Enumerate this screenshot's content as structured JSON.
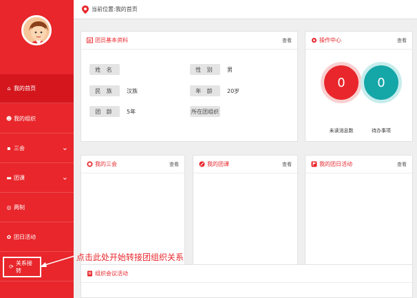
{
  "sidebar": {
    "items": [
      {
        "label": "我的首页",
        "icon": "home-icon"
      },
      {
        "label": "我的组织",
        "icon": "people-icon"
      },
      {
        "label": "三会",
        "icon": "clipboard-icon"
      },
      {
        "label": "团课",
        "icon": "folder-icon"
      },
      {
        "label": "两制",
        "icon": "target-icon"
      },
      {
        "label": "团日活动",
        "icon": "flower-icon"
      },
      {
        "label": "关系接转",
        "icon": "transfer-icon"
      }
    ]
  },
  "topbar": {
    "location": "当前位置:我的首页"
  },
  "profile": {
    "title": "团员基本资料",
    "more": "查看",
    "fields": {
      "name_label": "姓 名",
      "name_value": "",
      "gender_label": "性 别",
      "gender_value": "男",
      "ethnicity_label": "民 族",
      "ethnicity_value": "汉族",
      "age_label": "年 龄",
      "age_value": "20岁",
      "league_age_label": "团 龄",
      "league_age_value": "5年",
      "org_label": "所在团组织",
      "org_value": ""
    }
  },
  "ops": {
    "title": "操作中心",
    "more": "查看",
    "unread_count": "0",
    "unread_label": "未读消息数",
    "todo_count": "0",
    "todo_label": "待办事项"
  },
  "three_meetings": {
    "title": "我的三会",
    "more": "查看"
  },
  "league_class": {
    "title": "我的团课",
    "more": "查看"
  },
  "league_day": {
    "title": "我的团日活动",
    "more": "查看"
  },
  "org_meeting": {
    "title": "组织会议活动"
  },
  "annotation": {
    "text": "点击此处开始转接团组织关系"
  },
  "colors": {
    "primary": "#e8262b",
    "teal": "#15a6a8"
  }
}
